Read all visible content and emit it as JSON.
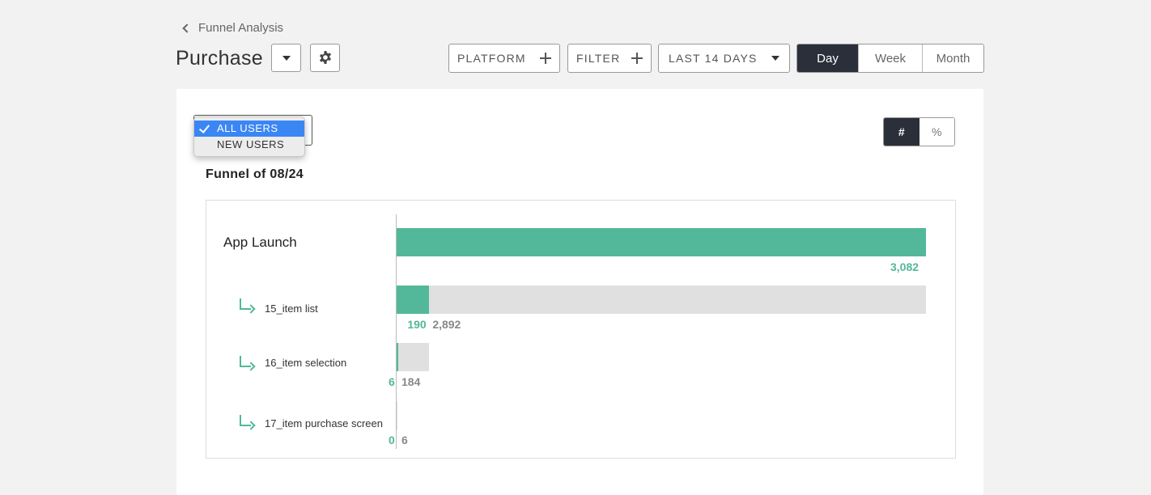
{
  "breadcrumb": {
    "label": "Funnel Analysis"
  },
  "page": {
    "title": "Purchase"
  },
  "toolbar": {
    "platform_label": "PLATFORM",
    "filter_label": "FILTER",
    "date_range_label": "LAST 14 DAYS",
    "granularity": [
      "Day",
      "Week",
      "Month"
    ],
    "granularity_selected": "Day"
  },
  "user_segment": {
    "options": [
      "ALL USERS",
      "NEW USERS"
    ],
    "selected": "ALL USERS"
  },
  "display_toggle": {
    "options": [
      "#",
      "%"
    ],
    "selected": "#"
  },
  "funnel": {
    "title": "Funnel of 08/24"
  },
  "colors": {
    "accent": "#53b89a",
    "dark": "#2b2f3a",
    "bar_bg": "#e0e0e0",
    "selection": "#3a86f5"
  },
  "chart_data": {
    "type": "bar",
    "title": "Funnel of 08/24",
    "categories": [
      "App Launch",
      "15_item list",
      "16_item selection",
      "17_item purchase screen"
    ],
    "series": [
      {
        "values": [
          3082,
          190,
          6,
          0
        ]
      }
    ],
    "dropped": [
      0,
      2892,
      184,
      6
    ],
    "labels": [
      {
        "converted": "3,082",
        "dropped": ""
      },
      {
        "converted": "190",
        "dropped": "2,892"
      },
      {
        "converted": "6",
        "dropped": "184"
      },
      {
        "converted": "0",
        "dropped": "6"
      }
    ],
    "xlim": [
      0,
      3082
    ]
  }
}
